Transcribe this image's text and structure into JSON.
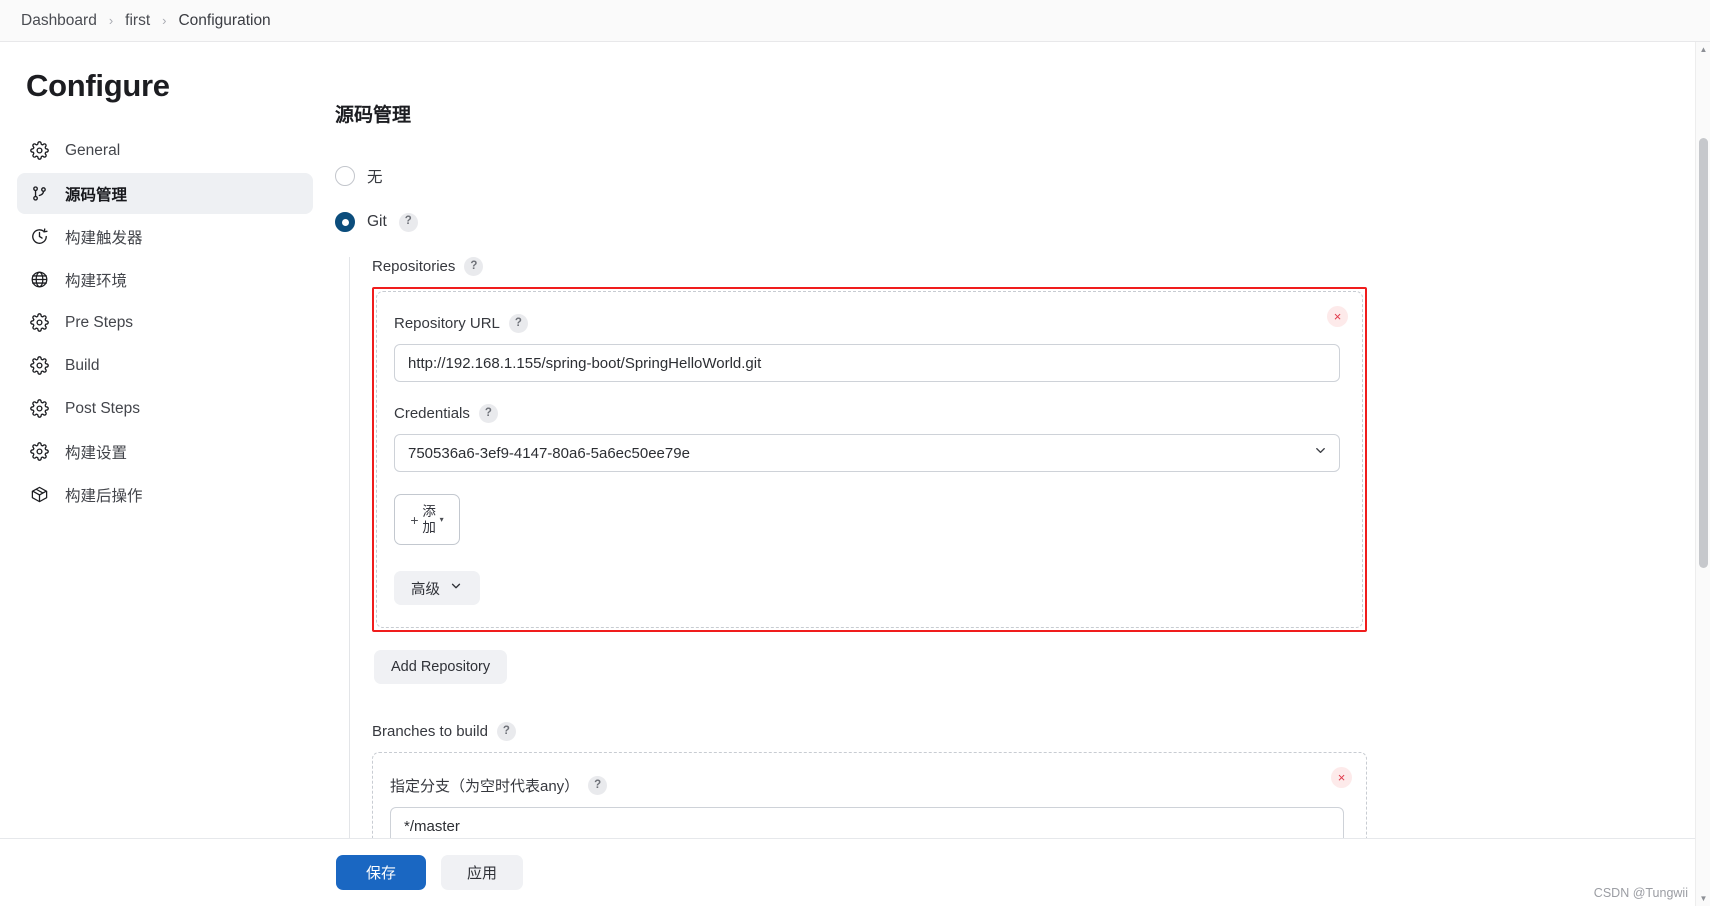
{
  "breadcrumb": {
    "items": [
      {
        "label": "Dashboard"
      },
      {
        "label": "first"
      },
      {
        "label": "Configuration"
      }
    ],
    "separator": "›"
  },
  "sidebar": {
    "title": "Configure",
    "items": [
      {
        "label": "General",
        "icon": "gear-icon",
        "active": false
      },
      {
        "label": "源码管理",
        "icon": "git-branch-icon",
        "active": true
      },
      {
        "label": "构建触发器",
        "icon": "clock-icon",
        "active": false
      },
      {
        "label": "构建环境",
        "icon": "globe-icon",
        "active": false
      },
      {
        "label": "Pre Steps",
        "icon": "gear-icon",
        "active": false
      },
      {
        "label": "Build",
        "icon": "gear-icon",
        "active": false
      },
      {
        "label": "Post Steps",
        "icon": "gear-icon",
        "active": false
      },
      {
        "label": "构建设置",
        "icon": "gear-icon",
        "active": false
      },
      {
        "label": "构建后操作",
        "icon": "package-icon",
        "active": false
      }
    ]
  },
  "main": {
    "section_title": "源码管理",
    "scm_options": [
      {
        "label": "无",
        "selected": false,
        "has_help": false
      },
      {
        "label": "Git",
        "selected": true,
        "has_help": true
      }
    ],
    "help_glyph": "?",
    "repositories": {
      "label": "Repositories",
      "repo": {
        "url_label": "Repository URL",
        "url_value": "http://192.168.1.155/spring-boot/SpringHelloWorld.git",
        "credentials_label": "Credentials",
        "credentials_value": "750536a6-3ef9-4147-80a6-5a6ec50ee79e",
        "add_button": {
          "plus": "+",
          "line1": "添",
          "line2": "加",
          "caret": "▾"
        },
        "advanced_label": "高级",
        "delete_glyph": "×"
      },
      "add_repository_label": "Add Repository"
    },
    "branches": {
      "label": "Branches to build",
      "branch_spec_label": "指定分支（为空时代表any）",
      "branch_spec_value": "*/master",
      "delete_glyph": "×"
    }
  },
  "action_bar": {
    "save_label": "保存",
    "apply_label": "应用"
  },
  "watermark": "CSDN @Tungwii",
  "colors": {
    "accent_blue": "#1a67c2",
    "radio_selected": "#0b4d7c",
    "annotation_red": "#f01d1d",
    "sidebar_active_bg": "#eef0f3"
  }
}
